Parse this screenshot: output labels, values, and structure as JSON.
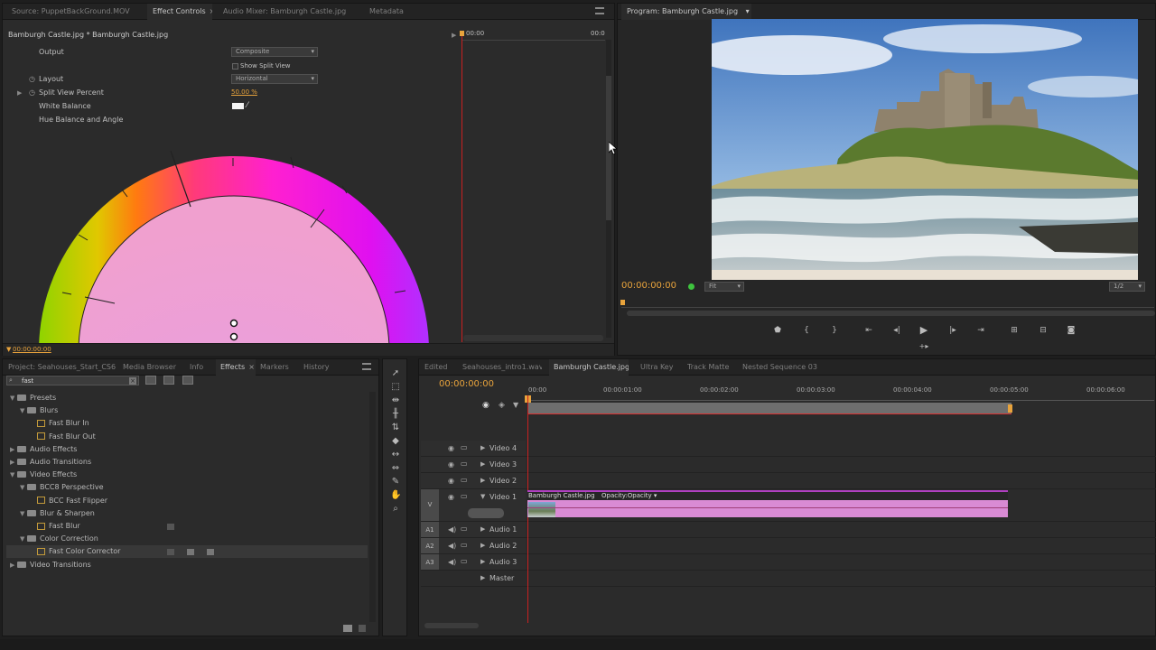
{
  "source_tabs": [
    {
      "label": "Source: PuppetBackGround.MOV",
      "active": false
    },
    {
      "label": "Effect Controls",
      "active": true
    },
    {
      "label": "Audio Mixer: Bamburgh Castle.jpg",
      "active": false
    },
    {
      "label": "Metadata",
      "active": false
    }
  ],
  "close_glyph": "×",
  "effect_controls": {
    "clip_title": "Bamburgh Castle.jpg * Bamburgh Castle.jpg",
    "timeline_start": "00:00",
    "timeline_end": "00:0",
    "output_label": "Output",
    "output_value": "Composite",
    "show_split_view": "Show Split View",
    "layout_label": "Layout",
    "layout_value": "Horizontal",
    "split_view_label": "Split View Percent",
    "split_view_value": "50.00 %",
    "white_balance_label": "White Balance",
    "hue_label": "Hue Balance and Angle",
    "timecode": "00:00:00:00"
  },
  "program": {
    "tab_label": "Program: Bamburgh Castle.jpg",
    "timecode": "00:00:00:00",
    "zoom": "Fit",
    "resolution": "1/2"
  },
  "project_tabs": [
    {
      "label": "Project: Seahouses_Start_CS6",
      "active": false
    },
    {
      "label": "Media Browser",
      "active": false
    },
    {
      "label": "Info",
      "active": false
    },
    {
      "label": "Effects",
      "active": true
    },
    {
      "label": "Markers",
      "active": false
    },
    {
      "label": "History",
      "active": false
    }
  ],
  "effects": {
    "search_value": "fast",
    "tree": [
      {
        "label": "Presets",
        "type": "folder",
        "level": 0,
        "open": true
      },
      {
        "label": "Blurs",
        "type": "folder",
        "level": 1,
        "open": true
      },
      {
        "label": "Fast Blur In",
        "type": "fx",
        "level": 2
      },
      {
        "label": "Fast Blur Out",
        "type": "fx",
        "level": 2
      },
      {
        "label": "Audio Effects",
        "type": "folder",
        "level": 0,
        "open": false
      },
      {
        "label": "Audio Transitions",
        "type": "folder",
        "level": 0,
        "open": false
      },
      {
        "label": "Video Effects",
        "type": "folder",
        "level": 0,
        "open": true
      },
      {
        "label": "BCC8 Perspective",
        "type": "folder",
        "level": 1,
        "open": true
      },
      {
        "label": "BCC Fast Flipper",
        "type": "fx",
        "level": 2
      },
      {
        "label": "Blur & Sharpen",
        "type": "folder",
        "level": 1,
        "open": true
      },
      {
        "label": "Fast Blur",
        "type": "fx",
        "level": 2
      },
      {
        "label": "Color Correction",
        "type": "folder",
        "level": 1,
        "open": true
      },
      {
        "label": "Fast Color Corrector",
        "type": "fx",
        "level": 2,
        "selected": true
      },
      {
        "label": "Video Transitions",
        "type": "folder",
        "level": 0,
        "open": false
      }
    ]
  },
  "timeline_tabs": [
    {
      "label": "Edited",
      "active": false
    },
    {
      "label": "Seahouses_intro1.wav",
      "active": false
    },
    {
      "label": "Bamburgh Castle.jpg",
      "active": true
    },
    {
      "label": "Ultra Key",
      "active": false
    },
    {
      "label": "Track Matte",
      "active": false
    },
    {
      "label": "Nested Sequence 03",
      "active": false
    }
  ],
  "timeline": {
    "timecode": "00:00:00:00",
    "ruler": [
      "00:00",
      "00:00:01:00",
      "00:00:02:00",
      "00:00:03:00",
      "00:00:04:00",
      "00:00:05:00",
      "00:00:06:00"
    ],
    "video_tracks": [
      "Video 4",
      "Video 3",
      "Video 2",
      "Video 1"
    ],
    "v_label": "V",
    "audio_tracks": [
      {
        "id": "A1",
        "name": "Audio 1"
      },
      {
        "id": "A2",
        "name": "Audio 2"
      },
      {
        "id": "A3",
        "name": "Audio 3"
      }
    ],
    "master": "Master",
    "clip_label": "Bamburgh Castle.jpg",
    "clip_opacity": "Opacity:Opacity"
  },
  "colors": {
    "accent": "#e8a33c",
    "clip": "#d98bd4",
    "playhead": "#d02020",
    "active_green": "#3ec43e"
  }
}
